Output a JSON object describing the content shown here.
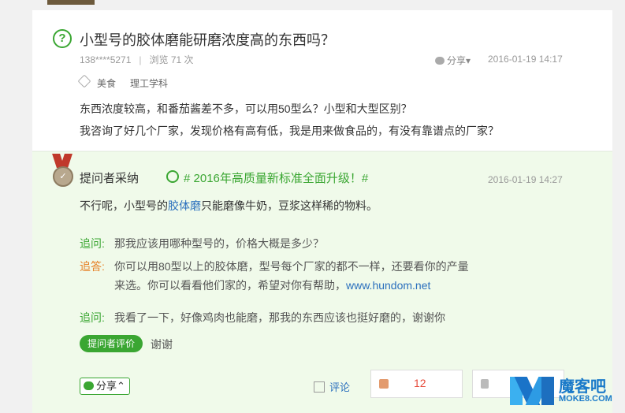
{
  "question": {
    "icon": "question-circle-icon",
    "title": "小型号的胶体磨能研磨浓度高的东西吗？",
    "asker": "138****5271",
    "views": "浏览 71 次",
    "share_label": "分享",
    "date": "2016-01-19 14:17",
    "tags": [
      "美食",
      "理工学科"
    ],
    "body_lines": [
      "东西浓度较高，和番茄酱差不多，可以用50型么？小型和大型区别？",
      "我咨询了好几个厂家，发现价格有高有低，我是用来做食品的，有没有靠谱点的厂家？"
    ]
  },
  "answer": {
    "badge_title": "提问者采纳",
    "promo": "# 2016年高质量新标准全面升级！#",
    "date": "2016-01-19 14:27",
    "text_before": "不行呢，小型号的",
    "text_highlight": "胶体磨",
    "text_after": "只能磨像牛奶，豆浆这样稀的物料。",
    "followups": [
      {
        "label": "追问:",
        "text": "那我应该用哪种型号的，价格大概是多少？"
      },
      {
        "label": "追答:",
        "line1": "你可以用80型以上的胶体磨，型号每个厂家的都不一样，还要看你的产量",
        "line2": "来选。你可以看看他们家的，希望对你有帮助，",
        "link": "www.hundom.net"
      },
      {
        "label": "追问:",
        "text": "我看了一下，好像鸡肉也能磨，那我的东西应该也挺好磨的，谢谢你"
      }
    ],
    "eval_button": "提问者评价",
    "thanks": "谢谢",
    "share_button": "分享",
    "comment": "评论",
    "like_count": "12"
  },
  "watermark": {
    "text": "魔客吧",
    "sub": "MOKE8.COM"
  }
}
